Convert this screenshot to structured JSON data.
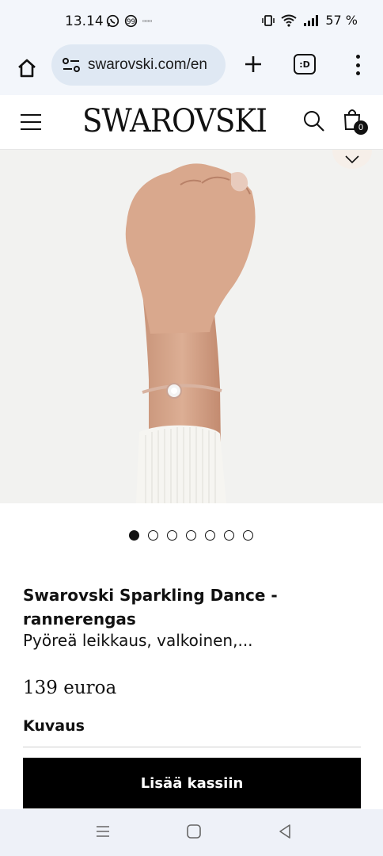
{
  "status": {
    "time": "13.14",
    "battery": "57 %",
    "small_label": "▫▫▫"
  },
  "browser": {
    "url": "swarovski.com/en",
    "tabs_label": ":D"
  },
  "site": {
    "logo": "SWAROVSKI",
    "cart_count": "0"
  },
  "gallery": {
    "total_images": 7,
    "active_index": 0
  },
  "product": {
    "title": "Swarovski Sparkling Dance - rannerengas",
    "subtitle": "Pyöreä leikkaus, valkoinen,...",
    "price": "139 euroa",
    "description_label": "Kuvaus",
    "add_to_cart_label": "Lisää kassiin"
  },
  "colors": {
    "accent": "#000000",
    "chrome_bg": "#f3f6fb",
    "url_bg": "#dfe8f3",
    "hero_bg": "#f2f2f0"
  },
  "icons": [
    "whatsapp-icon",
    "quote-icon",
    "vibrate-icon",
    "wifi-icon",
    "signal-icon",
    "home-icon",
    "site-settings-icon",
    "plus-icon",
    "more-icon",
    "hamburger-icon",
    "search-icon",
    "bag-icon",
    "chevron-down-icon",
    "recents-icon",
    "home-nav-icon",
    "back-icon"
  ]
}
